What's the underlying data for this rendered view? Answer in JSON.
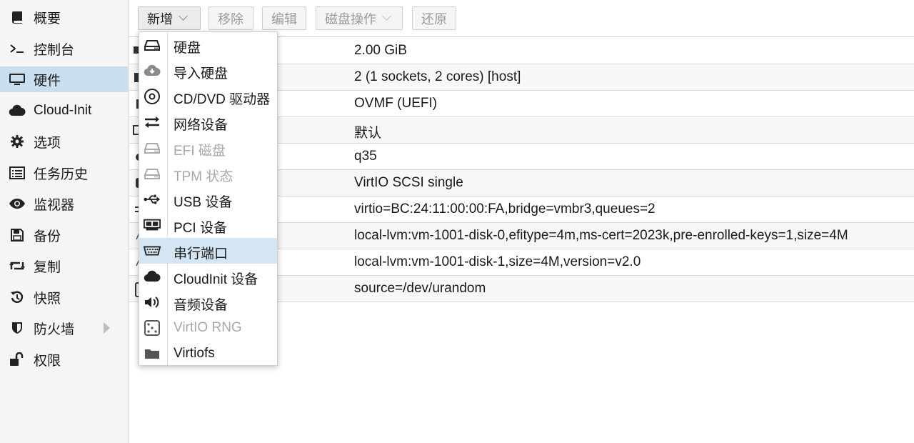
{
  "sidebar": {
    "items": [
      {
        "label": "概要",
        "icon": "book-icon"
      },
      {
        "label": "控制台",
        "icon": "terminal-icon"
      },
      {
        "label": "硬件",
        "icon": "monitor-icon"
      },
      {
        "label": "Cloud-Init",
        "icon": "cloud-icon"
      },
      {
        "label": "选项",
        "icon": "gear-icon"
      },
      {
        "label": "任务历史",
        "icon": "list-icon"
      },
      {
        "label": "监视器",
        "icon": "eye-icon"
      },
      {
        "label": "备份",
        "icon": "floppy-icon"
      },
      {
        "label": "复制",
        "icon": "retweet-icon"
      },
      {
        "label": "快照",
        "icon": "history-icon"
      },
      {
        "label": "防火墙",
        "icon": "shield-icon"
      },
      {
        "label": "权限",
        "icon": "unlock-icon"
      }
    ],
    "selected_index": 2
  },
  "toolbar": {
    "add_label": "新增",
    "remove_label": "移除",
    "edit_label": "编辑",
    "disk_action_label": "磁盘操作",
    "revert_label": "还原"
  },
  "grid": {
    "rows": [
      "2.00 GiB",
      "2 (1 sockets, 2 cores) [host]",
      "OVMF (UEFI)",
      "默认",
      "q35",
      "VirtIO SCSI single",
      "virtio=BC:24:11:00:00:FA,bridge=vmbr3,queues=2",
      "local-lvm:vm-1001-disk-0,efitype=4m,ms-cert=2023k,pre-enrolled-keys=1,size=4M",
      "local-lvm:vm-1001-disk-1,size=4M,version=v2.0",
      "source=/dev/urandom"
    ]
  },
  "menu": {
    "items": [
      {
        "label": "硬盘",
        "icon": "hdd-icon",
        "disabled": false
      },
      {
        "label": "导入硬盘",
        "icon": "cloud-download-icon",
        "disabled": false
      },
      {
        "label": "CD/DVD 驱动器",
        "icon": "cdrom-icon",
        "disabled": false
      },
      {
        "label": "网络设备",
        "icon": "exchange-icon",
        "disabled": false
      },
      {
        "label": "EFI 磁盘",
        "icon": "hdd-icon",
        "disabled": true
      },
      {
        "label": "TPM 状态",
        "icon": "hdd-icon",
        "disabled": true
      },
      {
        "label": "USB 设备",
        "icon": "usb-icon",
        "disabled": false
      },
      {
        "label": "PCI 设备",
        "icon": "pci-card-icon",
        "disabled": false
      },
      {
        "label": "串行端口",
        "icon": "serial-port-icon",
        "disabled": false
      },
      {
        "label": "CloudInit 设备",
        "icon": "cloud-icon",
        "disabled": false
      },
      {
        "label": "音频设备",
        "icon": "volume-icon",
        "disabled": false
      },
      {
        "label": "VirtIO RNG",
        "icon": "dice-icon",
        "disabled": true
      },
      {
        "label": "Virtiofs",
        "icon": "folder-icon",
        "disabled": false
      }
    ],
    "hover_index": 8
  },
  "colors": {
    "selected_bg": "#c9dff0",
    "hover_bg": "#d4e6f4",
    "disabled_text": "#a8a8a8"
  }
}
